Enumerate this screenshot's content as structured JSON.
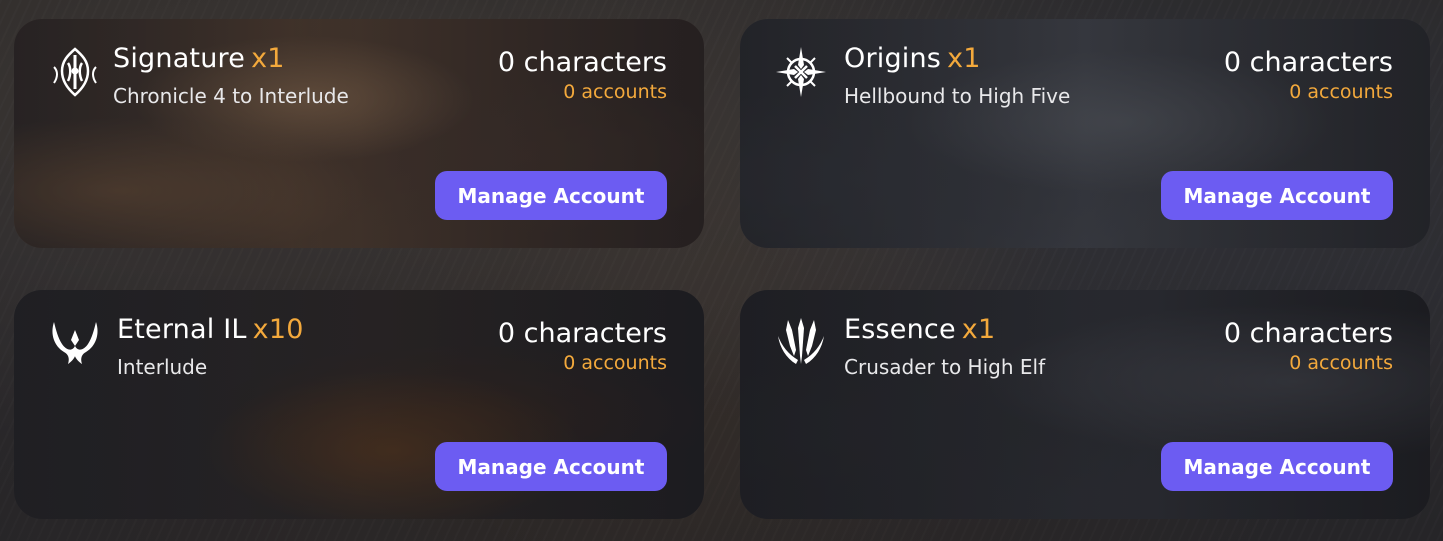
{
  "colors": {
    "accent": "#6c5cf2",
    "multiplier": "#f3a93c",
    "text": "#ffffff"
  },
  "servers": [
    {
      "name": "Signature",
      "multiplier": "x1",
      "chronicle": "Chronicle 4 to Interlude",
      "characters": "0 characters",
      "accounts": "0 accounts",
      "button_label": "Manage Account",
      "icon": "signature-emblem-icon"
    },
    {
      "name": "Origins",
      "multiplier": "x1",
      "chronicle": "Hellbound to High Five",
      "characters": "0 characters",
      "accounts": "0 accounts",
      "button_label": "Manage Account",
      "icon": "origins-star-emblem-icon"
    },
    {
      "name": "Eternal IL",
      "multiplier": "x10",
      "chronicle": "Interlude",
      "characters": "0 characters",
      "accounts": "0 accounts",
      "button_label": "Manage Account",
      "icon": "eternal-horns-emblem-icon"
    },
    {
      "name": "Essence",
      "multiplier": "x1",
      "chronicle": "Crusader to High Elf",
      "characters": "0 characters",
      "accounts": "0 accounts",
      "button_label": "Manage Account",
      "icon": "essence-blades-emblem-icon"
    }
  ]
}
